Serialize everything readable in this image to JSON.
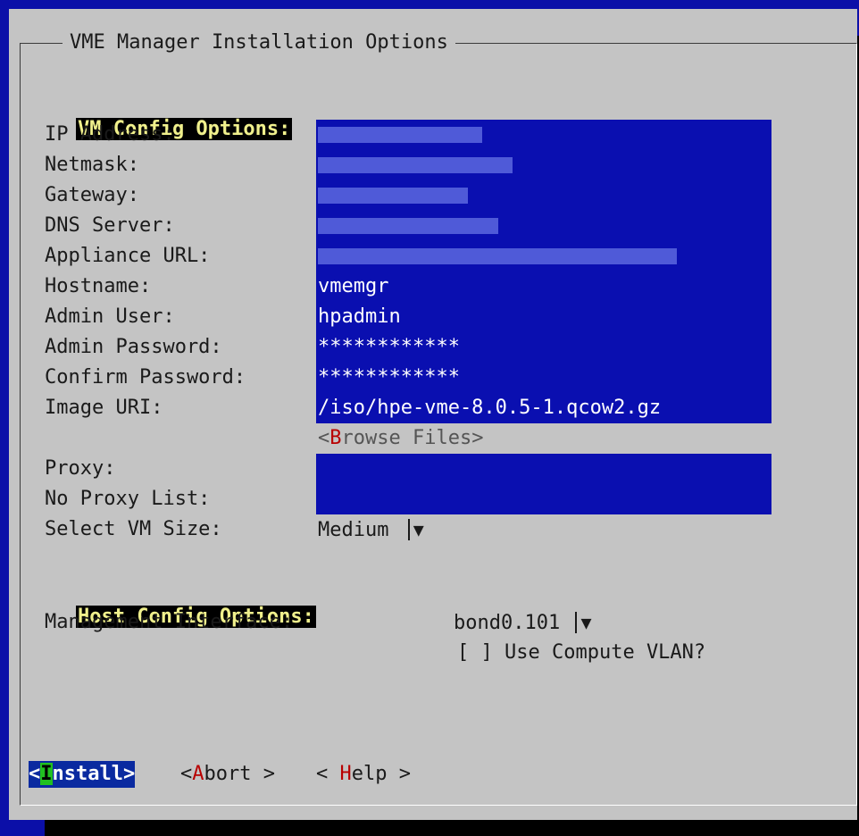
{
  "dialog": {
    "title": "VME Manager Installation Options"
  },
  "vm_section": {
    "heading": "VM Config Options:",
    "labels": {
      "ip": "IP Address:",
      "netmask": "Netmask:",
      "gateway": "Gateway:",
      "dns": "DNS Server:",
      "appliance": "Appliance URL:",
      "hostname": "Hostname:",
      "admin_user": "Admin User:",
      "admin_password": "Admin Password:",
      "confirm_password": "Confirm Password:",
      "image_uri": "Image URI:",
      "proxy": "Proxy:",
      "no_proxy": "No Proxy List:",
      "vm_size": "Select VM Size:"
    },
    "values": {
      "hostname": "vmemgr",
      "admin_user": "hpadmin",
      "admin_password": "************",
      "confirm_password": "************",
      "image_uri": "/iso/hpe-vme-8.0.5-1.qcow2.gz",
      "proxy": "",
      "no_proxy": "",
      "vm_size": "Medium"
    },
    "browse": {
      "open": "<",
      "hotkey": "B",
      "rest": "rowse Files>"
    }
  },
  "host_section": {
    "heading": "Host Config Options:",
    "mgmt_label": "Management Interface:",
    "mgmt_value": "bond0.101",
    "vlan_checkbox": "[ ]",
    "vlan_label": "Use Compute VLAN?"
  },
  "buttons": {
    "install": {
      "open": "<",
      "hotkey": "I",
      "rest": "nstall>"
    },
    "abort": {
      "open": "<",
      "hotkey": "A",
      "rest": "bort >"
    },
    "help": {
      "open": "< ",
      "hotkey": "H",
      "rest": "elp >"
    }
  },
  "icons": {
    "dropdown": "▼"
  },
  "colors": {
    "background": "#0b0fa8",
    "dialog": "#c4c4c4",
    "input_field": "#0a0fb0",
    "section_heading_text": "#f0f08c",
    "hotkey": "#b80000"
  }
}
